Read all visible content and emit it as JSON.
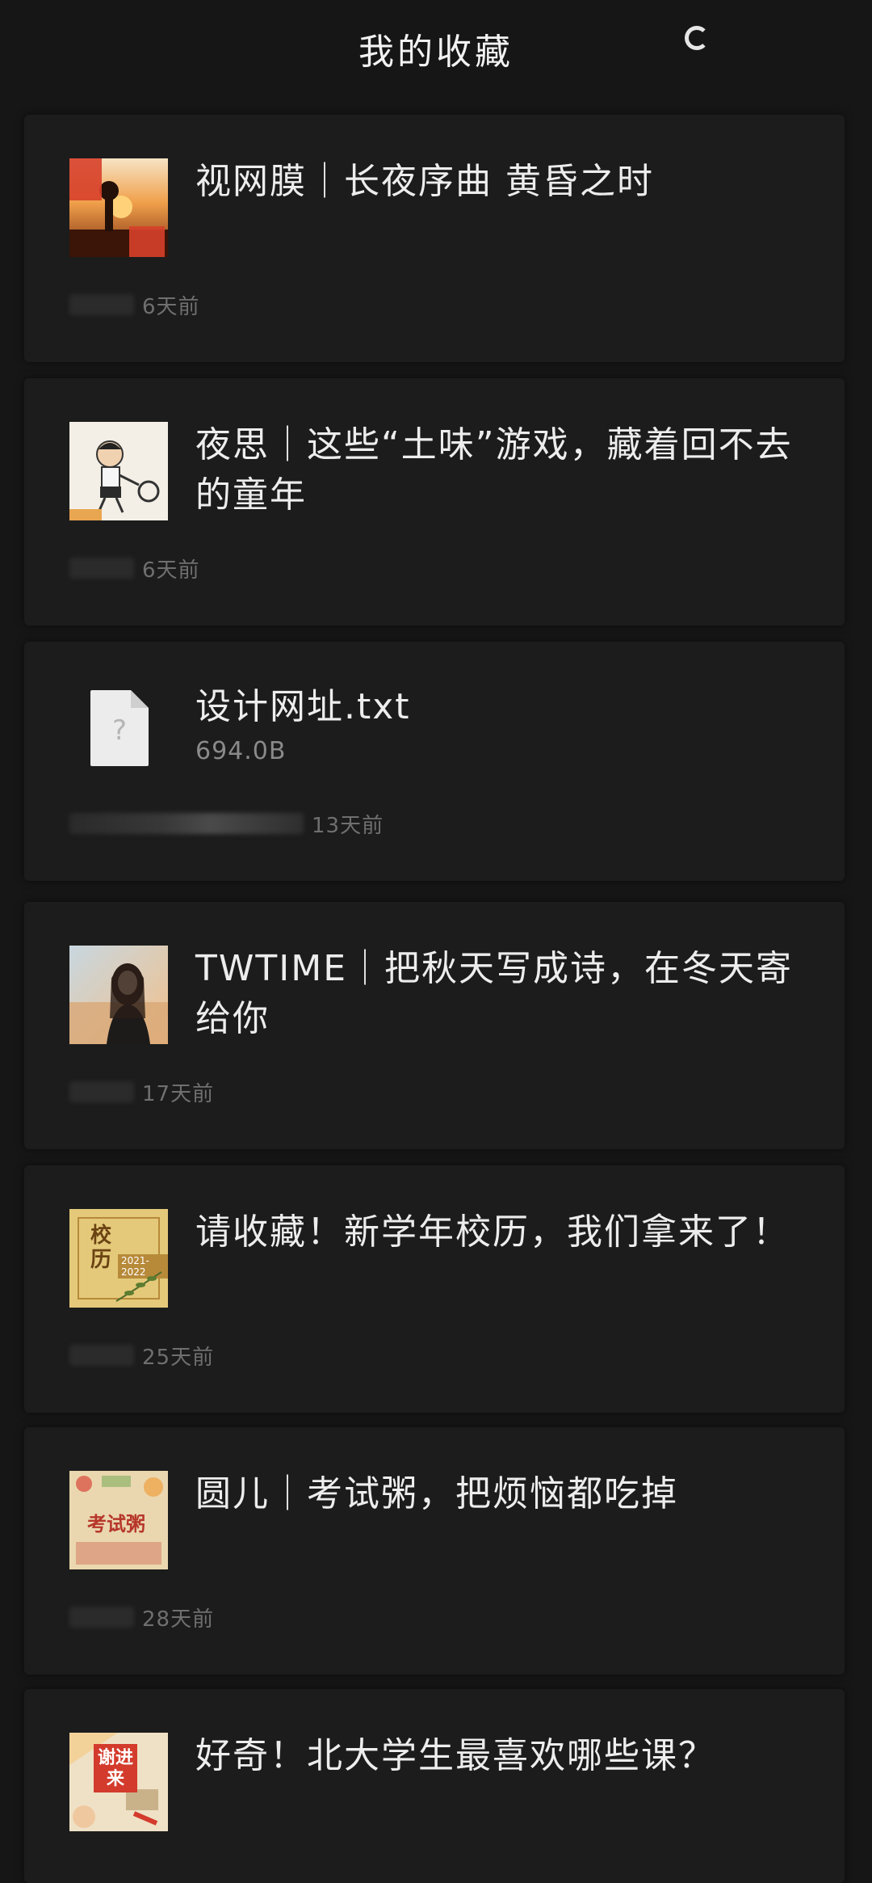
{
  "header": {
    "title": "我的收藏"
  },
  "items": [
    {
      "title": "视网膜｜长夜序曲 黄昏之时",
      "time": "6天前",
      "thumb_icon": "sunset-image"
    },
    {
      "title": "夜思｜这些“土味”游戏，藏着回不去的童年",
      "time": "6天前",
      "thumb_icon": "child-illustration-image"
    },
    {
      "title": "设计网址.txt",
      "size": "694.0B",
      "time": "13天前",
      "thumb_icon": "unknown-file-icon",
      "file_icon_glyph": "?"
    },
    {
      "title": "TWTIME｜把秋天写成诗，在冬天寄给你",
      "time": "17天前",
      "thumb_icon": "portrait-image"
    },
    {
      "title": "请收藏！新学年校历，我们拿来了！",
      "time": "25天前",
      "thumb_icon": "calendar-image",
      "thumb_text": "校历",
      "thumb_year": "2021-2022"
    },
    {
      "title": "圆儿｜考试粥，把烦恼都吃掉",
      "time": "28天前",
      "thumb_icon": "congee-image",
      "thumb_text": "考试粥"
    },
    {
      "title": "好奇！北大学生最喜欢哪些课？",
      "time": "",
      "thumb_icon": "lesson-poster-image",
      "thumb_text": "谢进来"
    }
  ]
}
